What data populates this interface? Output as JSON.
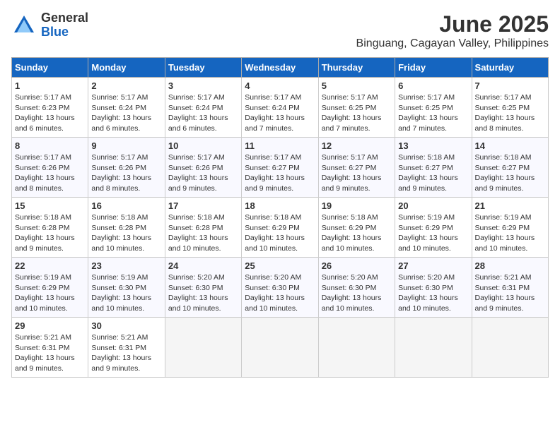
{
  "logo": {
    "general": "General",
    "blue": "Blue"
  },
  "title": {
    "month_year": "June 2025",
    "location": "Binguang, Cagayan Valley, Philippines"
  },
  "headers": [
    "Sunday",
    "Monday",
    "Tuesday",
    "Wednesday",
    "Thursday",
    "Friday",
    "Saturday"
  ],
  "weeks": [
    [
      {
        "day": "1",
        "sunrise": "Sunrise: 5:17 AM",
        "sunset": "Sunset: 6:23 PM",
        "daylight": "Daylight: 13 hours and 6 minutes."
      },
      {
        "day": "2",
        "sunrise": "Sunrise: 5:17 AM",
        "sunset": "Sunset: 6:24 PM",
        "daylight": "Daylight: 13 hours and 6 minutes."
      },
      {
        "day": "3",
        "sunrise": "Sunrise: 5:17 AM",
        "sunset": "Sunset: 6:24 PM",
        "daylight": "Daylight: 13 hours and 6 minutes."
      },
      {
        "day": "4",
        "sunrise": "Sunrise: 5:17 AM",
        "sunset": "Sunset: 6:24 PM",
        "daylight": "Daylight: 13 hours and 7 minutes."
      },
      {
        "day": "5",
        "sunrise": "Sunrise: 5:17 AM",
        "sunset": "Sunset: 6:25 PM",
        "daylight": "Daylight: 13 hours and 7 minutes."
      },
      {
        "day": "6",
        "sunrise": "Sunrise: 5:17 AM",
        "sunset": "Sunset: 6:25 PM",
        "daylight": "Daylight: 13 hours and 7 minutes."
      },
      {
        "day": "7",
        "sunrise": "Sunrise: 5:17 AM",
        "sunset": "Sunset: 6:25 PM",
        "daylight": "Daylight: 13 hours and 8 minutes."
      }
    ],
    [
      {
        "day": "8",
        "sunrise": "Sunrise: 5:17 AM",
        "sunset": "Sunset: 6:26 PM",
        "daylight": "Daylight: 13 hours and 8 minutes."
      },
      {
        "day": "9",
        "sunrise": "Sunrise: 5:17 AM",
        "sunset": "Sunset: 6:26 PM",
        "daylight": "Daylight: 13 hours and 8 minutes."
      },
      {
        "day": "10",
        "sunrise": "Sunrise: 5:17 AM",
        "sunset": "Sunset: 6:26 PM",
        "daylight": "Daylight: 13 hours and 9 minutes."
      },
      {
        "day": "11",
        "sunrise": "Sunrise: 5:17 AM",
        "sunset": "Sunset: 6:27 PM",
        "daylight": "Daylight: 13 hours and 9 minutes."
      },
      {
        "day": "12",
        "sunrise": "Sunrise: 5:17 AM",
        "sunset": "Sunset: 6:27 PM",
        "daylight": "Daylight: 13 hours and 9 minutes."
      },
      {
        "day": "13",
        "sunrise": "Sunrise: 5:18 AM",
        "sunset": "Sunset: 6:27 PM",
        "daylight": "Daylight: 13 hours and 9 minutes."
      },
      {
        "day": "14",
        "sunrise": "Sunrise: 5:18 AM",
        "sunset": "Sunset: 6:27 PM",
        "daylight": "Daylight: 13 hours and 9 minutes."
      }
    ],
    [
      {
        "day": "15",
        "sunrise": "Sunrise: 5:18 AM",
        "sunset": "Sunset: 6:28 PM",
        "daylight": "Daylight: 13 hours and 9 minutes."
      },
      {
        "day": "16",
        "sunrise": "Sunrise: 5:18 AM",
        "sunset": "Sunset: 6:28 PM",
        "daylight": "Daylight: 13 hours and 10 minutes."
      },
      {
        "day": "17",
        "sunrise": "Sunrise: 5:18 AM",
        "sunset": "Sunset: 6:28 PM",
        "daylight": "Daylight: 13 hours and 10 minutes."
      },
      {
        "day": "18",
        "sunrise": "Sunrise: 5:18 AM",
        "sunset": "Sunset: 6:29 PM",
        "daylight": "Daylight: 13 hours and 10 minutes."
      },
      {
        "day": "19",
        "sunrise": "Sunrise: 5:18 AM",
        "sunset": "Sunset: 6:29 PM",
        "daylight": "Daylight: 13 hours and 10 minutes."
      },
      {
        "day": "20",
        "sunrise": "Sunrise: 5:19 AM",
        "sunset": "Sunset: 6:29 PM",
        "daylight": "Daylight: 13 hours and 10 minutes."
      },
      {
        "day": "21",
        "sunrise": "Sunrise: 5:19 AM",
        "sunset": "Sunset: 6:29 PM",
        "daylight": "Daylight: 13 hours and 10 minutes."
      }
    ],
    [
      {
        "day": "22",
        "sunrise": "Sunrise: 5:19 AM",
        "sunset": "Sunset: 6:29 PM",
        "daylight": "Daylight: 13 hours and 10 minutes."
      },
      {
        "day": "23",
        "sunrise": "Sunrise: 5:19 AM",
        "sunset": "Sunset: 6:30 PM",
        "daylight": "Daylight: 13 hours and 10 minutes."
      },
      {
        "day": "24",
        "sunrise": "Sunrise: 5:20 AM",
        "sunset": "Sunset: 6:30 PM",
        "daylight": "Daylight: 13 hours and 10 minutes."
      },
      {
        "day": "25",
        "sunrise": "Sunrise: 5:20 AM",
        "sunset": "Sunset: 6:30 PM",
        "daylight": "Daylight: 13 hours and 10 minutes."
      },
      {
        "day": "26",
        "sunrise": "Sunrise: 5:20 AM",
        "sunset": "Sunset: 6:30 PM",
        "daylight": "Daylight: 13 hours and 10 minutes."
      },
      {
        "day": "27",
        "sunrise": "Sunrise: 5:20 AM",
        "sunset": "Sunset: 6:30 PM",
        "daylight": "Daylight: 13 hours and 10 minutes."
      },
      {
        "day": "28",
        "sunrise": "Sunrise: 5:21 AM",
        "sunset": "Sunset: 6:31 PM",
        "daylight": "Daylight: 13 hours and 9 minutes."
      }
    ],
    [
      {
        "day": "29",
        "sunrise": "Sunrise: 5:21 AM",
        "sunset": "Sunset: 6:31 PM",
        "daylight": "Daylight: 13 hours and 9 minutes."
      },
      {
        "day": "30",
        "sunrise": "Sunrise: 5:21 AM",
        "sunset": "Sunset: 6:31 PM",
        "daylight": "Daylight: 13 hours and 9 minutes."
      },
      null,
      null,
      null,
      null,
      null
    ]
  ]
}
